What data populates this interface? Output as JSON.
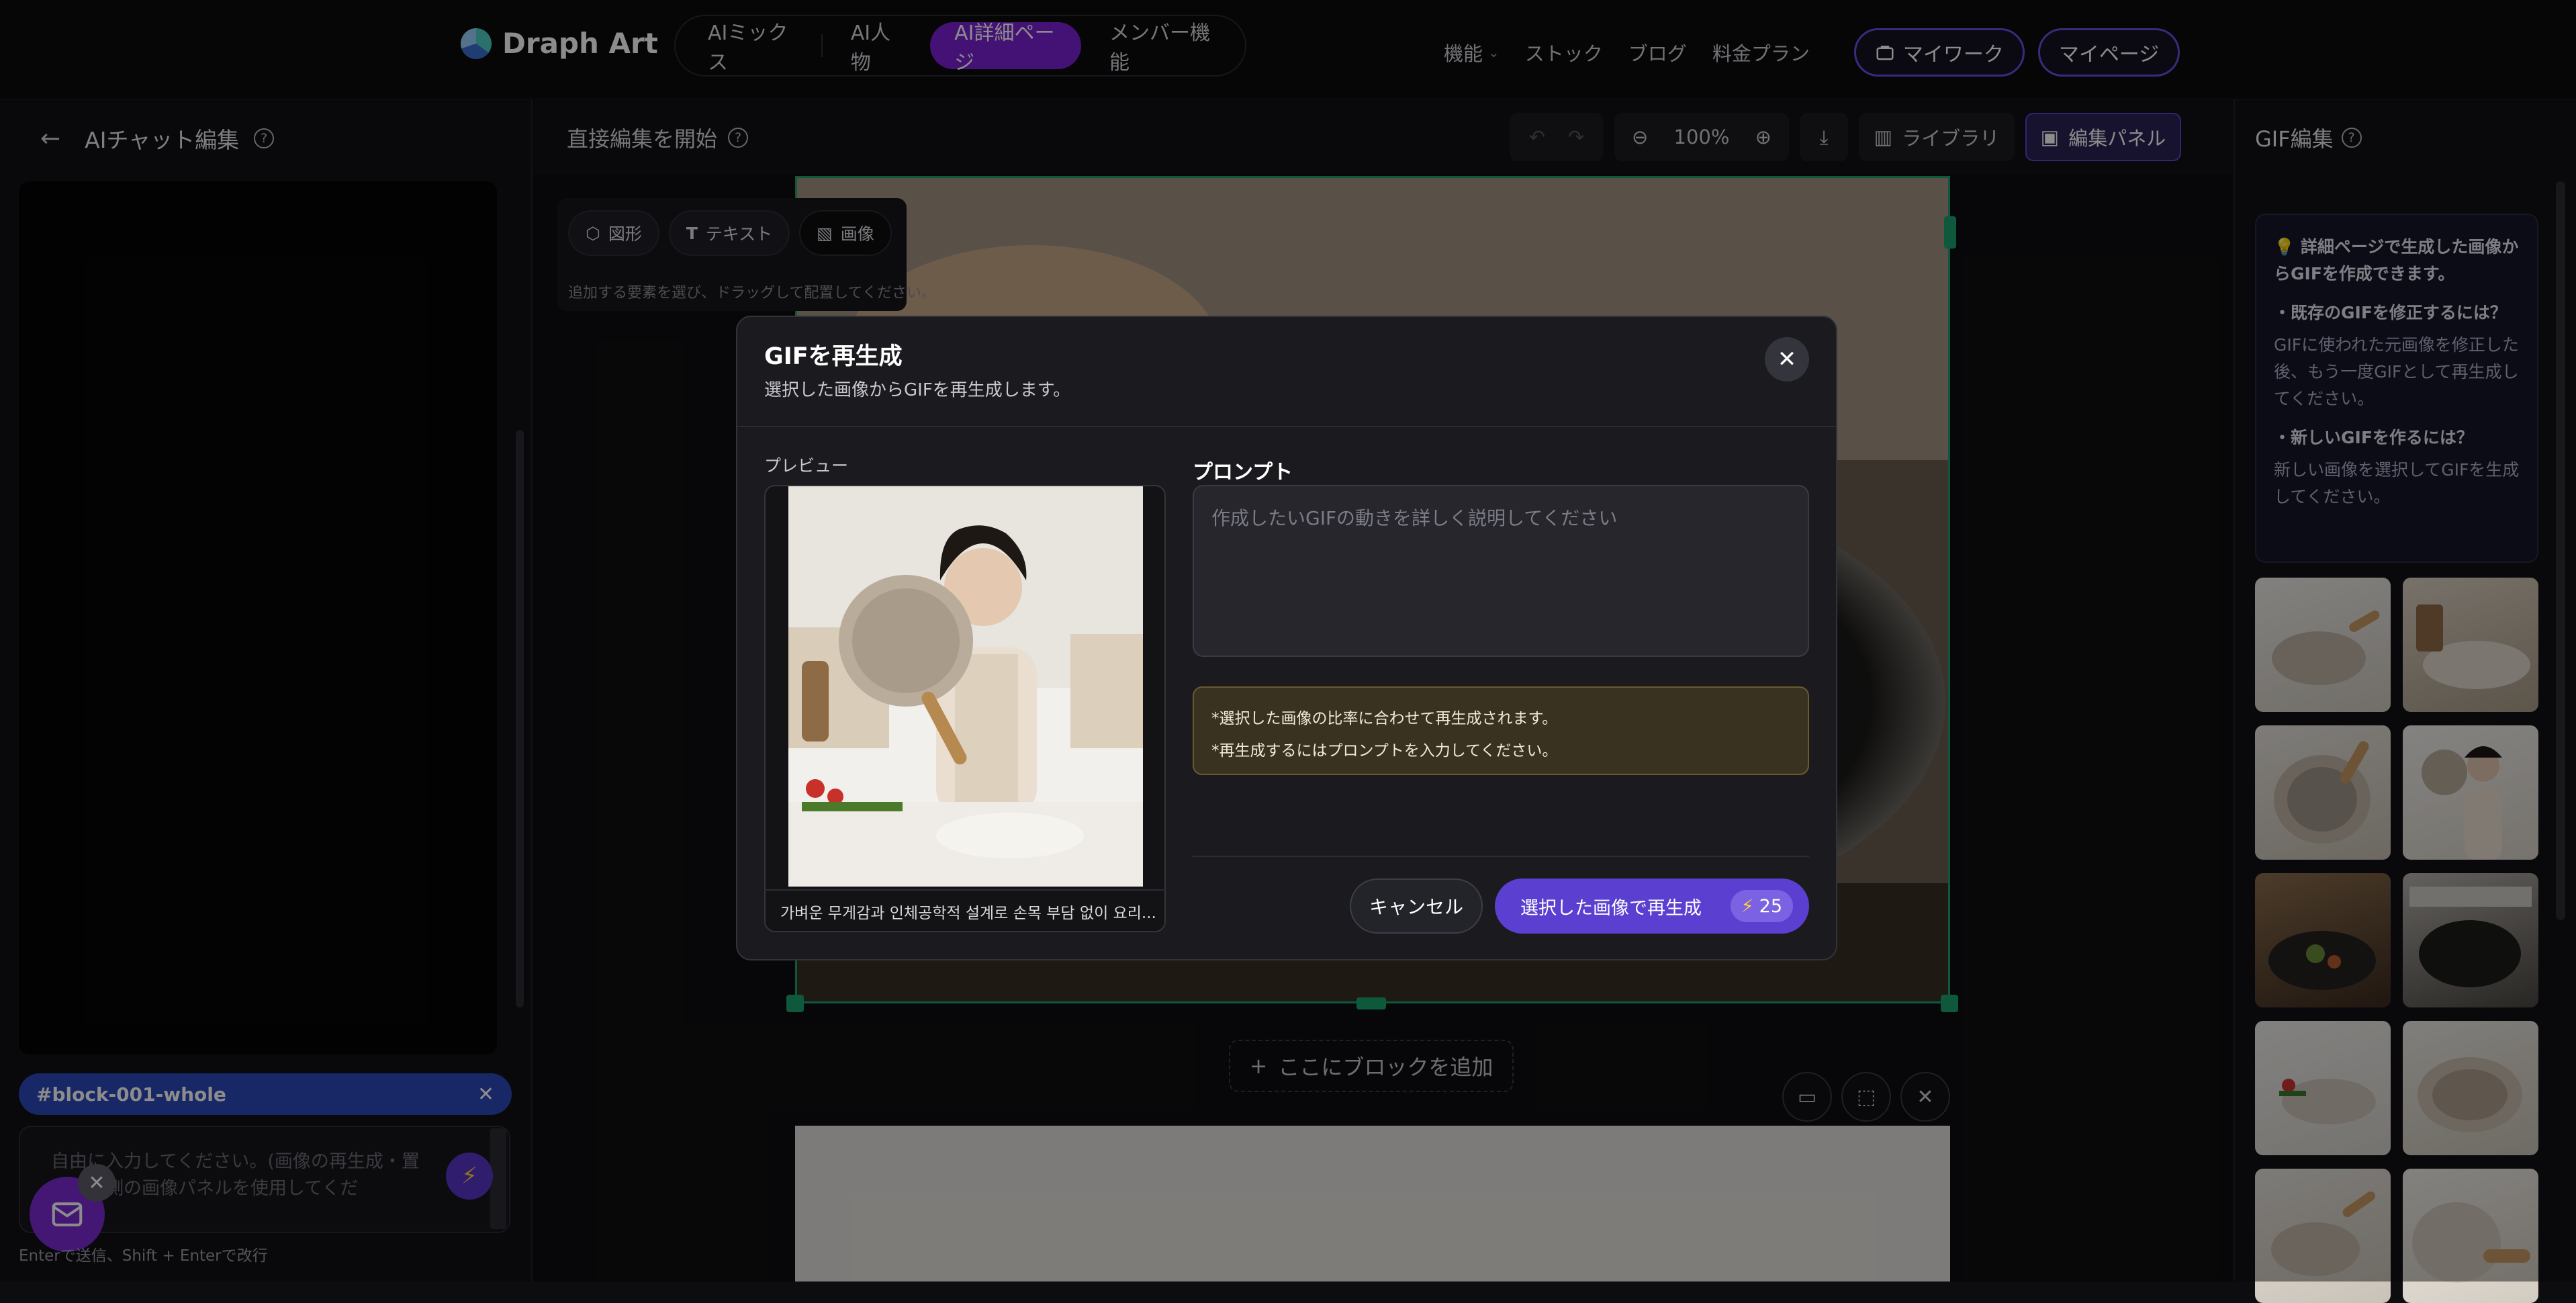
{
  "nav": {
    "brand": "Draph Art",
    "tabs": [
      "AIミックス",
      "AI人物",
      "AI詳細ページ",
      "メンバー機能"
    ],
    "active_tab": "AI詳細ページ",
    "links": {
      "features": "機能",
      "stock": "ストック",
      "blog": "ブログ",
      "pricing": "料金プラン"
    },
    "mywork": "マイワーク",
    "mypage": "マイページ"
  },
  "left_panel": {
    "title": "AIチャット編集",
    "block_tag": "#block-001-whole",
    "chat_placeholder": "自由に入力してください。(画像の再生成・置換は右側の画像パネルを使用してくだ",
    "hint": "Enterで送信、Shift + Enterで改行"
  },
  "editor": {
    "title": "直接編集を開始",
    "zoom": "100%",
    "library": "ライブラリ",
    "edit_panel": "編集パネル",
    "element_toolbar": {
      "shape": "図形",
      "text": "テキスト",
      "image": "画像",
      "hint": "追加する要素を選び、ドラッグして配置してください。"
    },
    "add_block": "ここにブロックを追加"
  },
  "right_panel": {
    "title": "GIF編集",
    "info": {
      "headline": "詳細ページで生成した画像からGIFを作成できます。",
      "q1": "・既存のGIFを修正するには？",
      "a1": "GIFに使われた元画像を修正した後、もう一度GIFとして再生成してください。",
      "q2": "・新しいGIFを作るには？",
      "a2": "新しい画像を選択してGIFを生成してください。"
    }
  },
  "modal": {
    "title": "GIFを再生成",
    "subtitle": "選択した画像からGIFを再生成します。",
    "preview_label": "プレビュー",
    "caption": "가벼운 무게감과 인체공학적 설계로 손목 부담 없이 요리...",
    "prompt_label": "プロンプト",
    "prompt_placeholder": "作成したいGIFの動きを詳しく説明してください",
    "prompt_value": "",
    "notice1": "*選択した画像の比率に合わせて再生成されます。",
    "notice2": "*再生成するにはプロンプトを入力してください。",
    "cancel": "キャンセル",
    "regenerate": "選択した画像で再生成",
    "credits": "25"
  },
  "colors": {
    "accent": "#5b3fd0",
    "active_tab": "#7b22d4",
    "selection": "#1aa36c",
    "tag": "#2d47b8"
  }
}
